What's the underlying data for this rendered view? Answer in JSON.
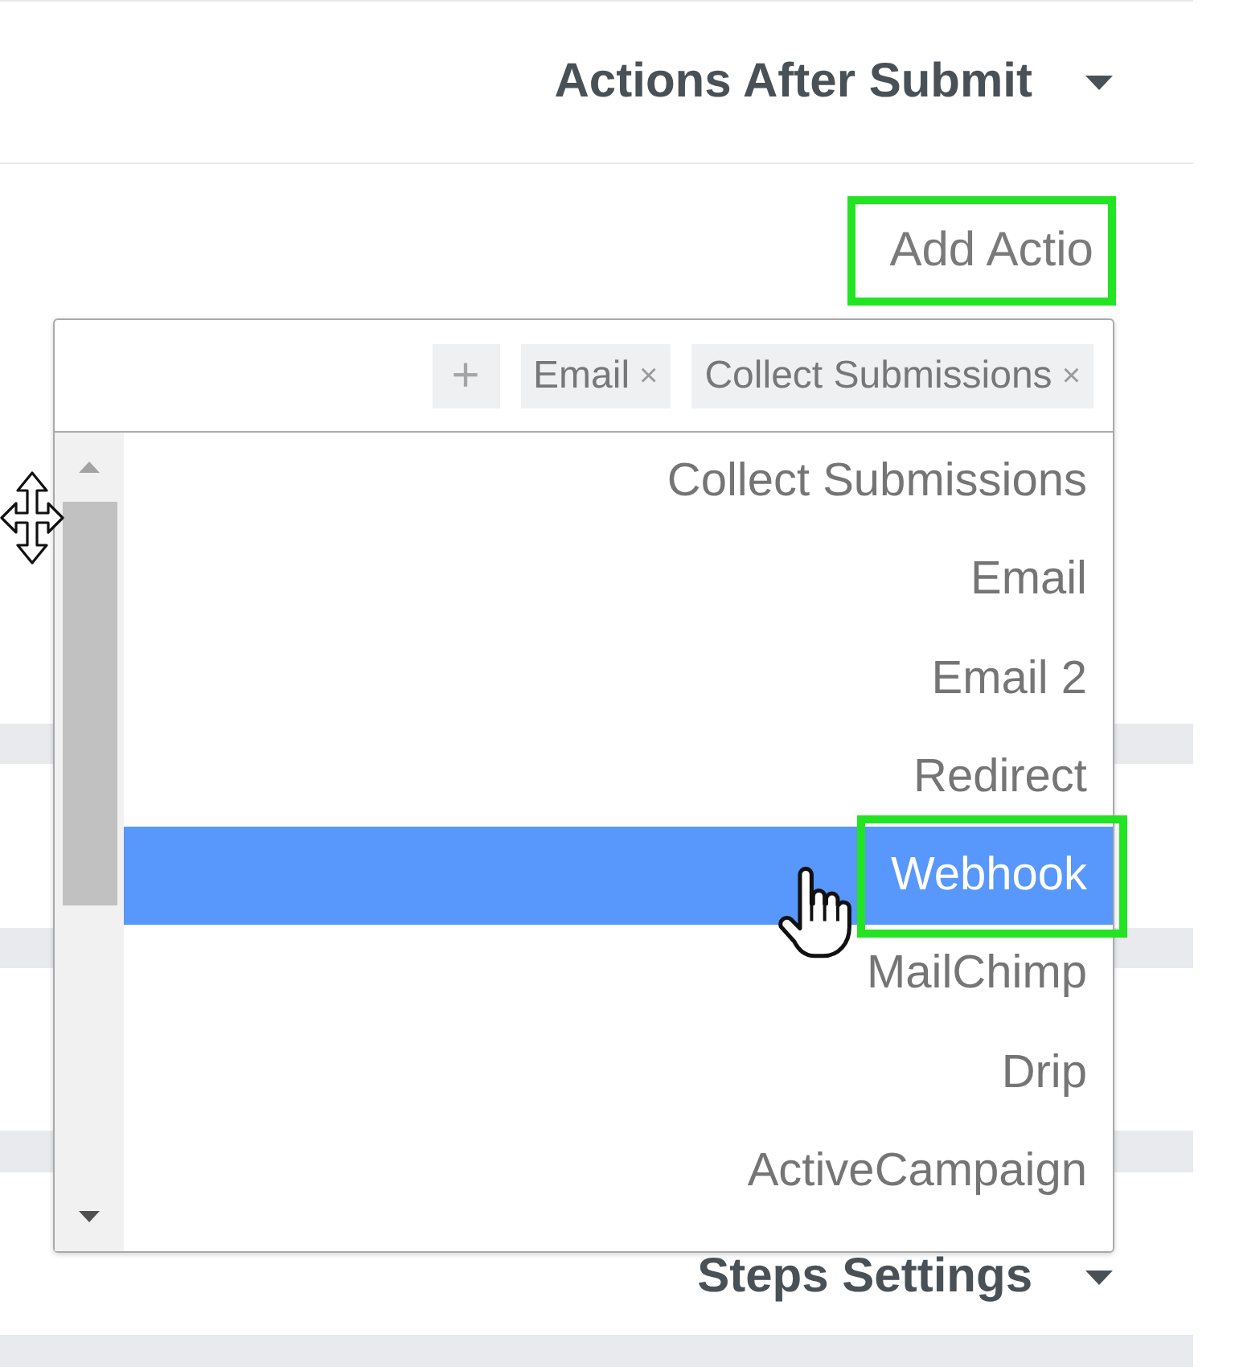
{
  "panel": {
    "section_header": {
      "title": "Actions After Submit"
    },
    "field": {
      "label": "Add Actio",
      "highlighted": true
    },
    "select": {
      "add_tag": "+",
      "tags": [
        {
          "label": "Email",
          "remove": "×"
        },
        {
          "label": "Collect Submissions",
          "remove": "×"
        }
      ],
      "options": [
        {
          "label": "Collect Submissions",
          "selected": false,
          "highlighted": false
        },
        {
          "label": "Email",
          "selected": false,
          "highlighted": false
        },
        {
          "label": "Email 2",
          "selected": false,
          "highlighted": false
        },
        {
          "label": "Redirect",
          "selected": false,
          "highlighted": false
        },
        {
          "label": "Webhook",
          "selected": true,
          "highlighted": true
        },
        {
          "label": "MailChimp",
          "selected": false,
          "highlighted": false
        },
        {
          "label": "Drip",
          "selected": false,
          "highlighted": false
        },
        {
          "label": "ActiveCampaign",
          "selected": false,
          "highlighted": false
        }
      ]
    },
    "next_section_header": {
      "title": "Steps Settings"
    }
  }
}
